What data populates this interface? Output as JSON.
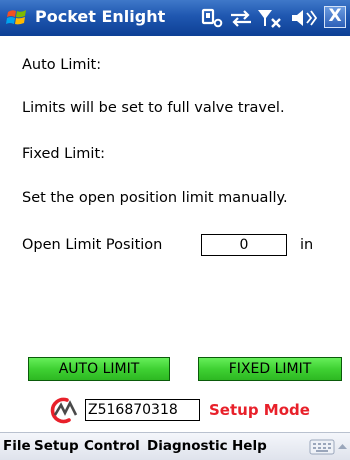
{
  "title_bar": {
    "app_title": "Pocket Enlight",
    "close_label": "X",
    "icons": [
      "windows-flag-icon",
      "connectivity-icon",
      "sync-icon",
      "signal-icon",
      "speaker-icon"
    ]
  },
  "content": {
    "auto_limit_heading": "Auto Limit:",
    "auto_limit_description": "Limits will be set to full valve travel.",
    "fixed_limit_heading": "Fixed Limit:",
    "fixed_limit_description": "Set the open position limit manually.",
    "open_limit": {
      "label": "Open Limit Position",
      "value": "0",
      "unit": "in"
    }
  },
  "buttons": {
    "auto_limit": "AUTO LIMIT",
    "fixed_limit": "FIXED LIMIT"
  },
  "status": {
    "serial": "Z516870318",
    "mode": "Setup Mode",
    "logo_icon": "brand-logo-icon",
    "mode_color": "#e8202a"
  },
  "menu": {
    "items": [
      "File",
      "Setup",
      "Control",
      "Diagnostic",
      "Help"
    ],
    "keyboard_icon": "keyboard-icon"
  },
  "colors": {
    "title_bar": "#1f57b0",
    "button_green": "#3fd133",
    "menu_bg": "#e8ebf2"
  }
}
